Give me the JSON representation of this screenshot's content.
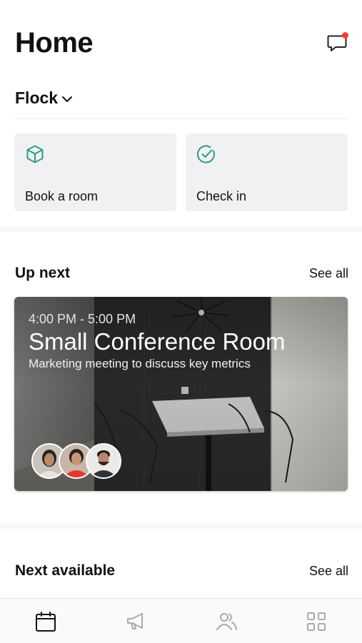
{
  "header": {
    "title": "Home"
  },
  "workspace": {
    "name": "Flock"
  },
  "actions": [
    {
      "label": "Book a room",
      "icon": "cube-icon"
    },
    {
      "label": "Check in",
      "icon": "check-circle-icon"
    }
  ],
  "up_next": {
    "title": "Up next",
    "see_all": "See all",
    "event": {
      "time": "4:00 PM - 5:00 PM",
      "room": "Small Conference Room",
      "description": "Marketing meeting to discuss key metrics"
    }
  },
  "next_available": {
    "title": "Next available",
    "see_all": "See all"
  },
  "tabbar": {
    "tabs": [
      "calendar-icon",
      "megaphone-icon",
      "people-icon",
      "grid-icon"
    ]
  },
  "colors": {
    "accent": "#2a9d83",
    "notification": "#ff3b30",
    "card_bg": "#f1f1f4"
  }
}
